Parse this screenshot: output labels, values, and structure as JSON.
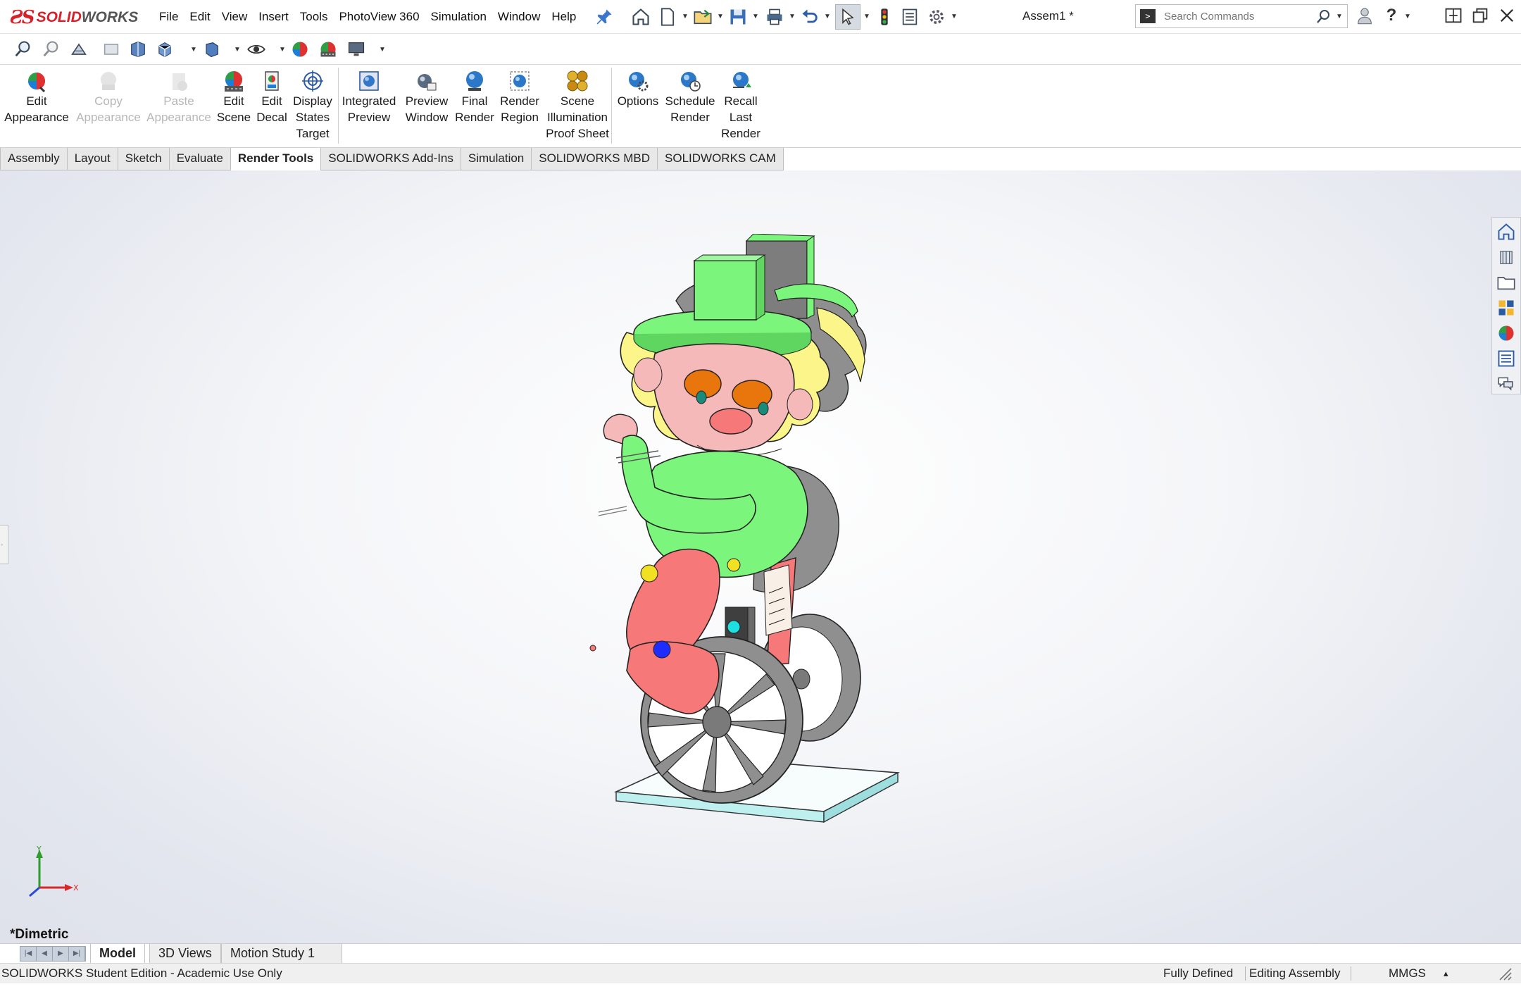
{
  "app": {
    "logo_text_brand": "SOLID",
    "logo_text_rest": "WORKS",
    "document_title": "Assem1 *"
  },
  "menu": {
    "items": [
      "File",
      "Edit",
      "View",
      "Insert",
      "Tools",
      "PhotoView 360",
      "Simulation",
      "Window",
      "Help"
    ]
  },
  "search": {
    "placeholder": "Search Commands",
    "terminal_glyph": ">"
  },
  "command_manager": {
    "commands": [
      {
        "label": "Edit\nAppearance",
        "icon": "appearance-sphere-icon",
        "enabled": true
      },
      {
        "label": "Copy\nAppearance",
        "icon": "copy-appearance-icon",
        "enabled": false
      },
      {
        "label": "Paste\nAppearance",
        "icon": "paste-appearance-icon",
        "enabled": false
      },
      {
        "label": "Edit\nScene",
        "icon": "edit-scene-icon",
        "enabled": true
      },
      {
        "label": "Edit\nDecal",
        "icon": "edit-decal-icon",
        "enabled": true
      },
      {
        "label": "Display\nStates\nTarget",
        "icon": "display-states-target-icon",
        "enabled": true
      },
      {
        "label": "Integrated\nPreview",
        "icon": "integrated-preview-icon",
        "enabled": true
      },
      {
        "label": "Preview\nWindow",
        "icon": "preview-window-icon",
        "enabled": true
      },
      {
        "label": "Final\nRender",
        "icon": "final-render-icon",
        "enabled": true
      },
      {
        "label": "Render\nRegion",
        "icon": "render-region-icon",
        "enabled": true
      },
      {
        "label": "Scene\nIllumination\nProof Sheet",
        "icon": "scene-illumination-icon",
        "enabled": true
      },
      {
        "label": "Options",
        "icon": "options-gear-icon",
        "enabled": true
      },
      {
        "label": "Schedule\nRender",
        "icon": "schedule-render-icon",
        "enabled": true
      },
      {
        "label": "Recall\nLast\nRender",
        "icon": "recall-last-render-icon",
        "enabled": true
      }
    ]
  },
  "tabs": {
    "items": [
      "Assembly",
      "Layout",
      "Sketch",
      "Evaluate",
      "Render Tools",
      "SOLIDWORKS Add-Ins",
      "Simulation",
      "SOLIDWORKS MBD",
      "SOLIDWORKS CAM"
    ],
    "active": "Render Tools"
  },
  "viewport": {
    "view_orientation": "*Dimetric",
    "triad_axes": {
      "x": "X",
      "y": "Y"
    }
  },
  "model_tabs": {
    "items": [
      "Model",
      "3D Views",
      "Motion Study 1"
    ],
    "active": "Model"
  },
  "status": {
    "edition": "SOLIDWORKS Student Edition - Academic Use Only",
    "definition": "Fully Defined",
    "mode": "Editing Assembly",
    "units": "MMGS",
    "units_caret": "▴"
  },
  "colors": {
    "brand_red": "#d8202a",
    "hat_green": "#7cf57c",
    "hair_yellow": "#fbf58a",
    "face_pink": "#f6b9b9",
    "eye_orange": "#e8760c",
    "leg_red": "#f67878",
    "wheel_gray": "#8f8f8f",
    "base_cyan": "#bff0f0"
  }
}
